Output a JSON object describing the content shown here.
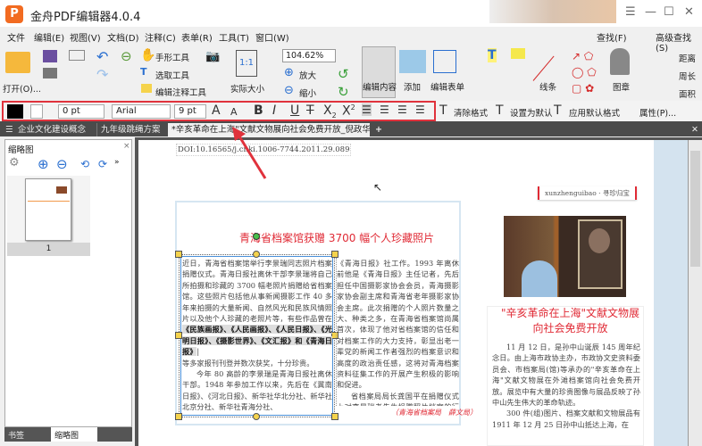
{
  "app": {
    "title": "金舟PDF编辑器4.0.4",
    "logo": "P"
  },
  "menu": [
    "文件",
    "编辑(E)",
    "视图(V)",
    "文档(D)",
    "注释(C)",
    "表单(R)",
    "工具(T)",
    "窗口(W)"
  ],
  "search": {
    "find": "查找(F)",
    "advanced": "高级查找(S)"
  },
  "ribbon": {
    "open": "打开(O)...",
    "hand": "手形工具",
    "select": "选取工具",
    "edit_annot": "编辑注释工具",
    "actual": "实际大小",
    "zoom": "104.62%",
    "zoom_in": "放大",
    "zoom_out": "缩小",
    "edit_content": "编辑内容",
    "add": "添加",
    "edit_form": "编辑表单",
    "line": "线条",
    "stamp": "图章",
    "distance": "距离",
    "perimeter": "周长",
    "area": "面积"
  },
  "format": {
    "stroke": "0 pt",
    "font": "Arial",
    "size": "9 pt",
    "clear": "清除格式",
    "set_default": "设置为默认",
    "apply_default": "应用默认格式",
    "props": "属性(P)..."
  },
  "tabs": [
    "企业文化建设概念",
    "九年级跳绳方案",
    "*辛亥革命在上海\"文献文物展向社会免费开放_倪政华 *"
  ],
  "panel": {
    "title": "缩略图",
    "page_num": "1",
    "bottom_tabs": [
      "书签",
      "缩略图"
    ]
  },
  "doc": {
    "doi": "DOI:10.16565/j.cnki.1006-7744.2011.29.089",
    "headline": "青海省档案馆获赠 3700 幅个人珍藏照片",
    "col1a": "近日，青海省档案馆举行李景瑞同志照片档案捐赠仪式。青海日报社离休干部李景瑞将自己所拍摄和珍藏的 3700 幅老照片捐赠给省档案馆。这些照片包括他从事新闻摄影工作 40 多年来拍摄的大量新闻、自然风光和民族风情照片以及他个人珍藏的老照片等，有些作品曾在",
    "col1b": "《民族画报》、《人民画报》、《人民日报》、《光明日报》、《摄影世界》、《文汇报》和《青海日报》",
    "col1c": "等多家报刊刊登并数次获奖，十分珍贵。",
    "col1d": "今年 80 高龄的李景瑞是青海日报社离休干部。1948 年参加工作以来，先后在《冀南日报》、《河北日报》、新华社华北分社、新华社北京分社、新华社青海分社、",
    "col2": "《青海日报》社工作。1993 年离休前他是《青海日报》主任记者，先后担任中国摄影家协会会员，青海摄影家协会副主席和青海省老年摄影家协会主席。此次捐赠的个人照片数量之大、种类之多，在青海省档案馆尚属首次，体现了他对省档案馆的信任和对档案工作的大力支持，彰显出老一辈党的新闻工作者强烈的档案意识和高度的政治责任感，这将对青海档案资料征集工作的开展产生积极的影响和促进。",
    "col2b": "省档案局局长龚国平在捐赠仪式上对李景瑞老先生捐赠照片档案的行为给予了高度评价，并为其颁发了捐赠证书。",
    "credit": "（青海省档案局　薛文局）",
    "tag": "xunzhenguibao · 寻珍归宝",
    "headline2": "\"辛亥革命在上海\"文献文物展向社会免费开放",
    "col3": "11 月 12 日，是孙中山诞辰 145 周年纪念日。由上海市政协主办，市政协文史资料委员会、市档案局(馆)等承办的\"辛亥革命在上海\"文献文物展在外滩档案馆向社会免费开放。展览中有大量的珍贵图像与展品反映了孙中山先生伟大的革命轨迹。",
    "col3b": "300 件(组)图片、档案文献和文物展品有 1911 年 12 月 25 日孙中山抵达上海，在"
  },
  "colors": {
    "accent": "#e02a35",
    "tabbar": "#4b4b4b"
  }
}
